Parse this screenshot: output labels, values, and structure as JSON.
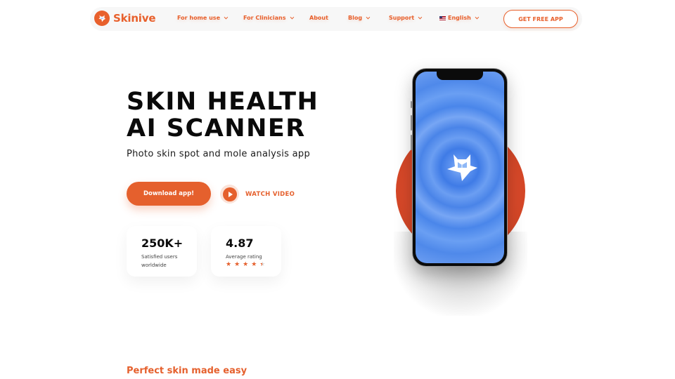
{
  "brand": {
    "name": "Skinive",
    "accent_color": "#e5602d",
    "logo_icon": "fox-mascot-icon"
  },
  "nav": {
    "items": [
      {
        "label": "For home use",
        "has_dropdown": true
      },
      {
        "label": "For Clinicians",
        "has_dropdown": true
      },
      {
        "label": "About",
        "has_dropdown": false
      },
      {
        "label": "Blog",
        "has_dropdown": true
      },
      {
        "label": "Support",
        "has_dropdown": true
      },
      {
        "label": "English",
        "has_dropdown": true,
        "icon": "us-flag-icon"
      }
    ],
    "cta_label": "GET FREE APP"
  },
  "hero": {
    "title_line1": "SKIN HEALTH",
    "title_line2": "AI SCANNER",
    "subtitle": "Photo skin spot and mole analysis app",
    "download_label": "Download app!",
    "watch_video_label": "WATCH VIDEO"
  },
  "stats": [
    {
      "value": "250K+",
      "label": "Satisfied users worldwide"
    },
    {
      "value": "4.87",
      "label": "Average rating",
      "stars": 4.5,
      "max_stars": 5
    }
  ],
  "phone": {
    "screen_color": "#4a84e8",
    "backdrop_color": "#d84c24",
    "screen_icon": "fox-mascot-icon"
  },
  "next_section": {
    "heading": "Perfect skin made easy"
  }
}
